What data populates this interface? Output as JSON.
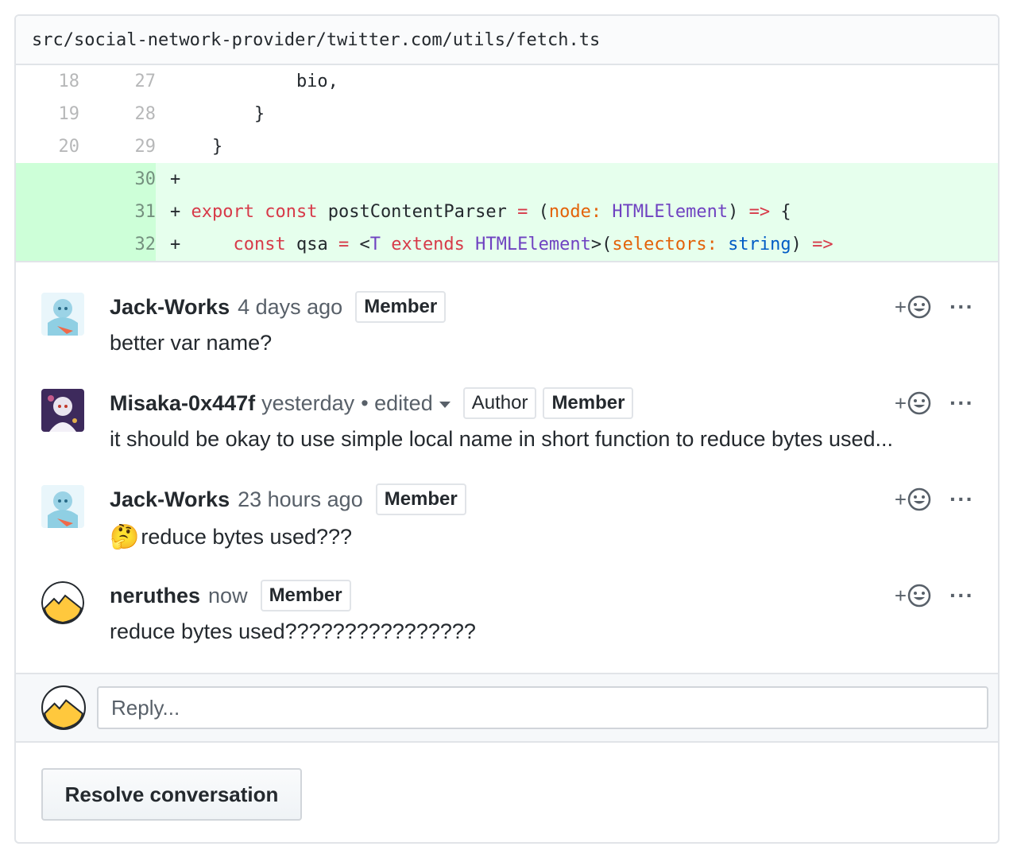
{
  "file": {
    "path": "src/social-network-provider/twitter.com/utils/fetch.ts"
  },
  "diff": [
    {
      "old": "18",
      "new": "27",
      "type": "context",
      "code": "            bio,"
    },
    {
      "old": "19",
      "new": "28",
      "type": "context",
      "code": "        }"
    },
    {
      "old": "20",
      "new": "29",
      "type": "context",
      "code": "    }"
    },
    {
      "old": "",
      "new": "30",
      "type": "add",
      "code": "+"
    },
    {
      "old": "",
      "new": "31",
      "type": "add",
      "code": "+ export const postContentParser = (node: HTMLElement) => {"
    },
    {
      "old": "",
      "new": "32",
      "type": "add",
      "code": "+     const qsa = <T extends HTMLElement>(selectors: string) =>"
    }
  ],
  "comments": [
    {
      "author": "Jack-Works",
      "time": "4 days ago",
      "edited": "",
      "badges": [
        "Member"
      ],
      "body": "better var name?",
      "avatar": "anime-avatar-blue"
    },
    {
      "author": "Misaka-0x447f",
      "time": "yesterday",
      "edited": "• edited",
      "badges": [
        "Author",
        "Member"
      ],
      "body": "it should be okay to use simple local name in short function to reduce bytes used...",
      "avatar": "anime-avatar-purple"
    },
    {
      "author": "Jack-Works",
      "time": "23 hours ago",
      "edited": "",
      "badges": [
        "Member"
      ],
      "body": "reduce bytes used???",
      "emoji": "🤔",
      "avatar": "anime-avatar-blue"
    },
    {
      "author": "neruthes",
      "time": "now",
      "edited": "",
      "badges": [
        "Member"
      ],
      "body": "reduce bytes used????????????????",
      "avatar": "mountain-avatar"
    }
  ],
  "actions": {
    "reaction_plus": "+",
    "more": "···"
  },
  "reply": {
    "placeholder": "Reply..."
  },
  "resolve": {
    "label": "Resolve conversation"
  }
}
